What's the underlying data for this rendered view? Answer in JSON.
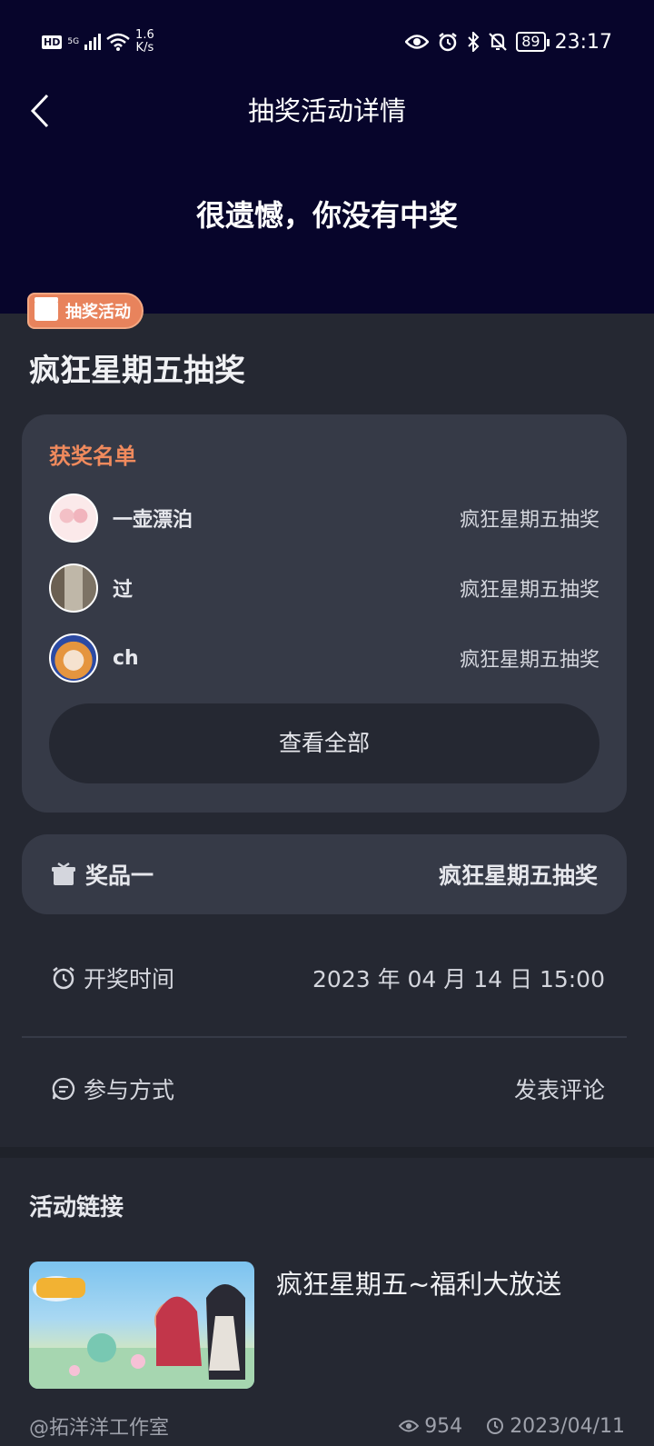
{
  "status_bar": {
    "network_hd": "HD",
    "network_5g": "5G",
    "speed_value": "1.6",
    "speed_unit": "K/s",
    "battery": "89",
    "time": "23:17"
  },
  "nav": {
    "title": "抽奖活动详情"
  },
  "result": {
    "message": "很遗憾，你没有中奖"
  },
  "activity": {
    "badge_label": "抽奖活动",
    "title": "疯狂星期五抽奖"
  },
  "winners": {
    "heading": "获奖名单",
    "list": [
      {
        "name": "一壶漂泊",
        "prize": "疯狂星期五抽奖"
      },
      {
        "name": "过",
        "prize": "疯狂星期五抽奖"
      },
      {
        "name": "ch",
        "prize": "疯狂星期五抽奖"
      }
    ],
    "view_all_label": "查看全部"
  },
  "prize": {
    "label": "奖品一",
    "value": "疯狂星期五抽奖"
  },
  "draw_time": {
    "label": "开奖时间",
    "value": "2023 年 04 月 14 日 15:00"
  },
  "participation": {
    "label": "参与方式",
    "value": "发表评论"
  },
  "activity_link": {
    "heading": "活动链接",
    "post_title": "疯狂星期五~福利大放送",
    "author": "@拓洋洋工作室",
    "views": "954",
    "date": "2023/04/11"
  },
  "colors": {
    "header_bg": "#07052b",
    "page_bg": "#252832",
    "card_bg": "#363a47",
    "accent_orange": "#f08a5d"
  }
}
